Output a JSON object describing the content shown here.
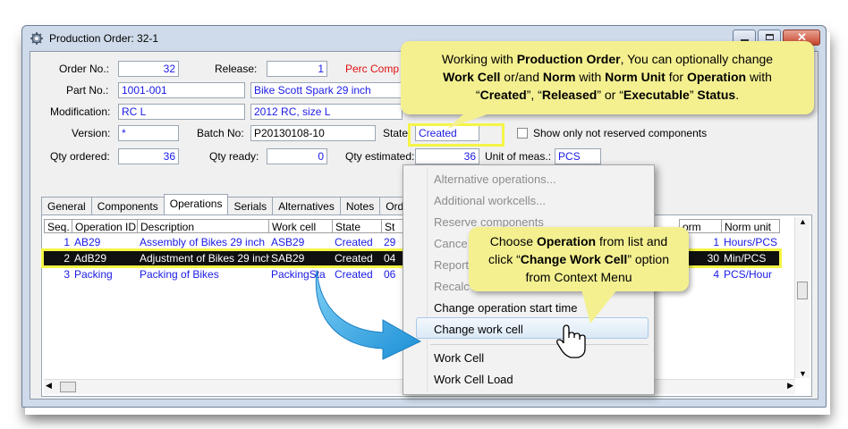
{
  "window": {
    "title": "Production Order: 32-1"
  },
  "form": {
    "order_no_label": "Order No.:",
    "order_no": "32",
    "release_label": "Release:",
    "release": "1",
    "perc_comp_label": "Perc Comp P",
    "part_no_label": "Part No.:",
    "part_no": "1001-001",
    "part_desc": "Bike Scott Spark 29 inch",
    "modification_label": "Modification:",
    "modification": "RC L",
    "modification_desc": "2012 RC, size L",
    "version_label": "Version:",
    "version": "*",
    "batch_no_label": "Batch No:",
    "batch_no": "P20130108-10",
    "state_label": "State:",
    "state": "Created",
    "reserved_label": "Show only not reserved components",
    "qty_ordered_label": "Qty ordered:",
    "qty_ordered": "36",
    "qty_ready_label": "Qty ready:",
    "qty_ready": "0",
    "qty_estimated_label": "Qty estimated:",
    "qty_estimated": "36",
    "unit_label": "Unit of meas.:",
    "unit": "PCS"
  },
  "tabs": [
    "General",
    "Components",
    "Operations",
    "Serials",
    "Alternatives",
    "Notes",
    "Ord"
  ],
  "grid": {
    "headers": [
      "Seq.",
      "Operation ID",
      "Description",
      "Work cell",
      "State",
      "St",
      "orm",
      "Norm unit"
    ],
    "rows": [
      {
        "seq": "1",
        "op_id": "AB29",
        "desc": "Assembly of Bikes 29 inch",
        "work_cell": "ASB29",
        "state": "Created",
        "st": "29",
        "norm": "1",
        "norm_unit": "Hours/PCS"
      },
      {
        "seq": "2",
        "op_id": "AdB29",
        "desc": "Adjustment of Bikes 29 inch",
        "work_cell": "SAB29",
        "state": "Created",
        "st": "04",
        "norm": "30",
        "norm_unit": "Min/PCS"
      },
      {
        "seq": "3",
        "op_id": "Packing",
        "desc": "Packing of Bikes",
        "work_cell": "PackingSta",
        "state": "Created",
        "st": "06",
        "norm": "4",
        "norm_unit": "PCS/Hour"
      }
    ]
  },
  "context_menu": {
    "items": [
      {
        "label": "Alternative operations...",
        "disabled": true
      },
      {
        "label": "Additional workcells...",
        "disabled": true
      },
      {
        "label": "Reserve components",
        "disabled": true
      },
      {
        "label": "Cance",
        "disabled": true
      },
      {
        "label": "Report",
        "disabled": true
      },
      {
        "label": "Recalc",
        "disabled": true
      },
      {
        "label": "Change operation start time",
        "disabled": false
      },
      {
        "label": "Change work cell",
        "disabled": false
      },
      {
        "label": "Work Cell",
        "disabled": false
      },
      {
        "label": "Work Cell Load",
        "disabled": false
      }
    ]
  },
  "callouts": {
    "top": {
      "line1_a": "Working with ",
      "line1_b": "Production Order",
      "line1_c": ", You can optionally change",
      "line2_a": "Work Cell",
      "line2_b": " or/and ",
      "line2_c": "Norm",
      "line2_d": " with ",
      "line2_e": "Norm Unit",
      "line2_f": " for ",
      "line2_g": "Operation",
      "line2_h": " with",
      "line3_a": "“",
      "line3_b": "Created",
      "line3_c": "”, “",
      "line3_d": "Released",
      "line3_e": "” or “",
      "line3_f": "Executable",
      "line3_g": "” ",
      "line3_h": "Status",
      "line3_i": "."
    },
    "bottom": {
      "line1_a": "Choose ",
      "line1_b": "Operation",
      "line1_c": " from list and",
      "line2_a": "click “",
      "line2_b": "Change Work Cell",
      "line2_c": "” option",
      "line3": "from Context Menu"
    }
  },
  "colors": {
    "highlight": "#f5f546",
    "callout": "#f4f090",
    "link_blue": "#1a1ae6",
    "arrow": "#2f9fe0"
  }
}
